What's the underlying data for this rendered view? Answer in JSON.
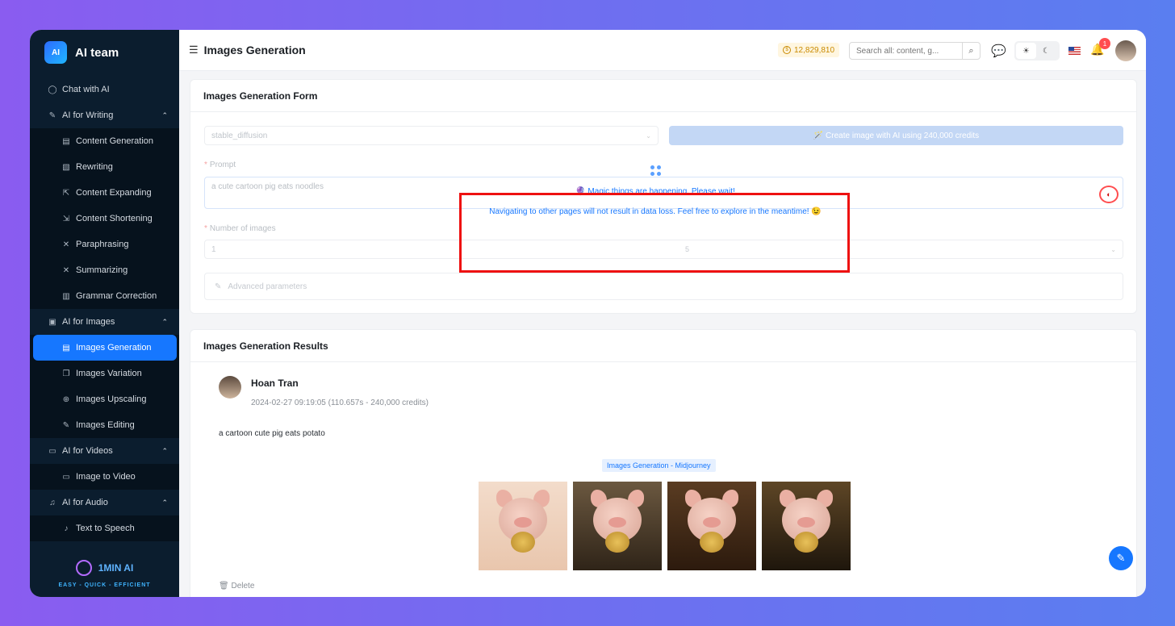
{
  "app": {
    "name": "AI team",
    "logo_text": "AI"
  },
  "sidebar": {
    "items": [
      {
        "label": "Chat with AI",
        "icon": "chat-icon"
      },
      {
        "label": "AI for Writing",
        "icon": "edit-icon",
        "children": [
          "Content Generation",
          "Rewriting",
          "Content Expanding",
          "Content Shortening",
          "Paraphrasing",
          "Summarizing",
          "Grammar Correction"
        ]
      },
      {
        "label": "AI for Images",
        "icon": "image-icon",
        "children": [
          "Images Generation",
          "Images Variation",
          "Images Upscaling",
          "Images Editing"
        ],
        "active_child": "Images Generation"
      },
      {
        "label": "AI for Videos",
        "icon": "video-icon",
        "children": [
          "Image to Video"
        ]
      },
      {
        "label": "AI for Audio",
        "icon": "mic-icon",
        "children": [
          "Text to Speech"
        ]
      }
    ],
    "footer": {
      "brand": "1MIN AI",
      "tagline": "EASY - QUICK - EFFICIENT"
    }
  },
  "header": {
    "title": "Images Generation",
    "credits": "12,829,810",
    "search_placeholder": "Search all: content, g...",
    "notifications": "1"
  },
  "form": {
    "title": "Images Generation Form",
    "model_value": "stable_diffusion",
    "create_button": "🪄 Create image with AI using 240,000 credits",
    "prompt_label": "Prompt",
    "prompt_value": "a cute cartoon pig eats noodles",
    "num_images_label": "Number of images",
    "num_images_value": "1",
    "num_images_overlap": "5",
    "advanced_label": "Advanced parameters"
  },
  "loading": {
    "message_1": "🔮 Magic things are happening. Please wait!",
    "message_2": "Navigating to other pages will not result in data loss. Feel free to explore in the meantime! 😉"
  },
  "results": {
    "title": "Images Generation Results",
    "user_name": "Hoan Tran",
    "meta": "2024-02-27 09:19:05 (110.657s - 240,000 credits)",
    "prompt": "a cartoon cute pig eats potato",
    "tag": "Images Generation - Midjourney",
    "image_count": 4,
    "delete_label": "Delete"
  },
  "colors": {
    "accent": "#1677ff",
    "sidebar_bg": "#0b1d2e",
    "highlight_box": "#ee1111"
  }
}
